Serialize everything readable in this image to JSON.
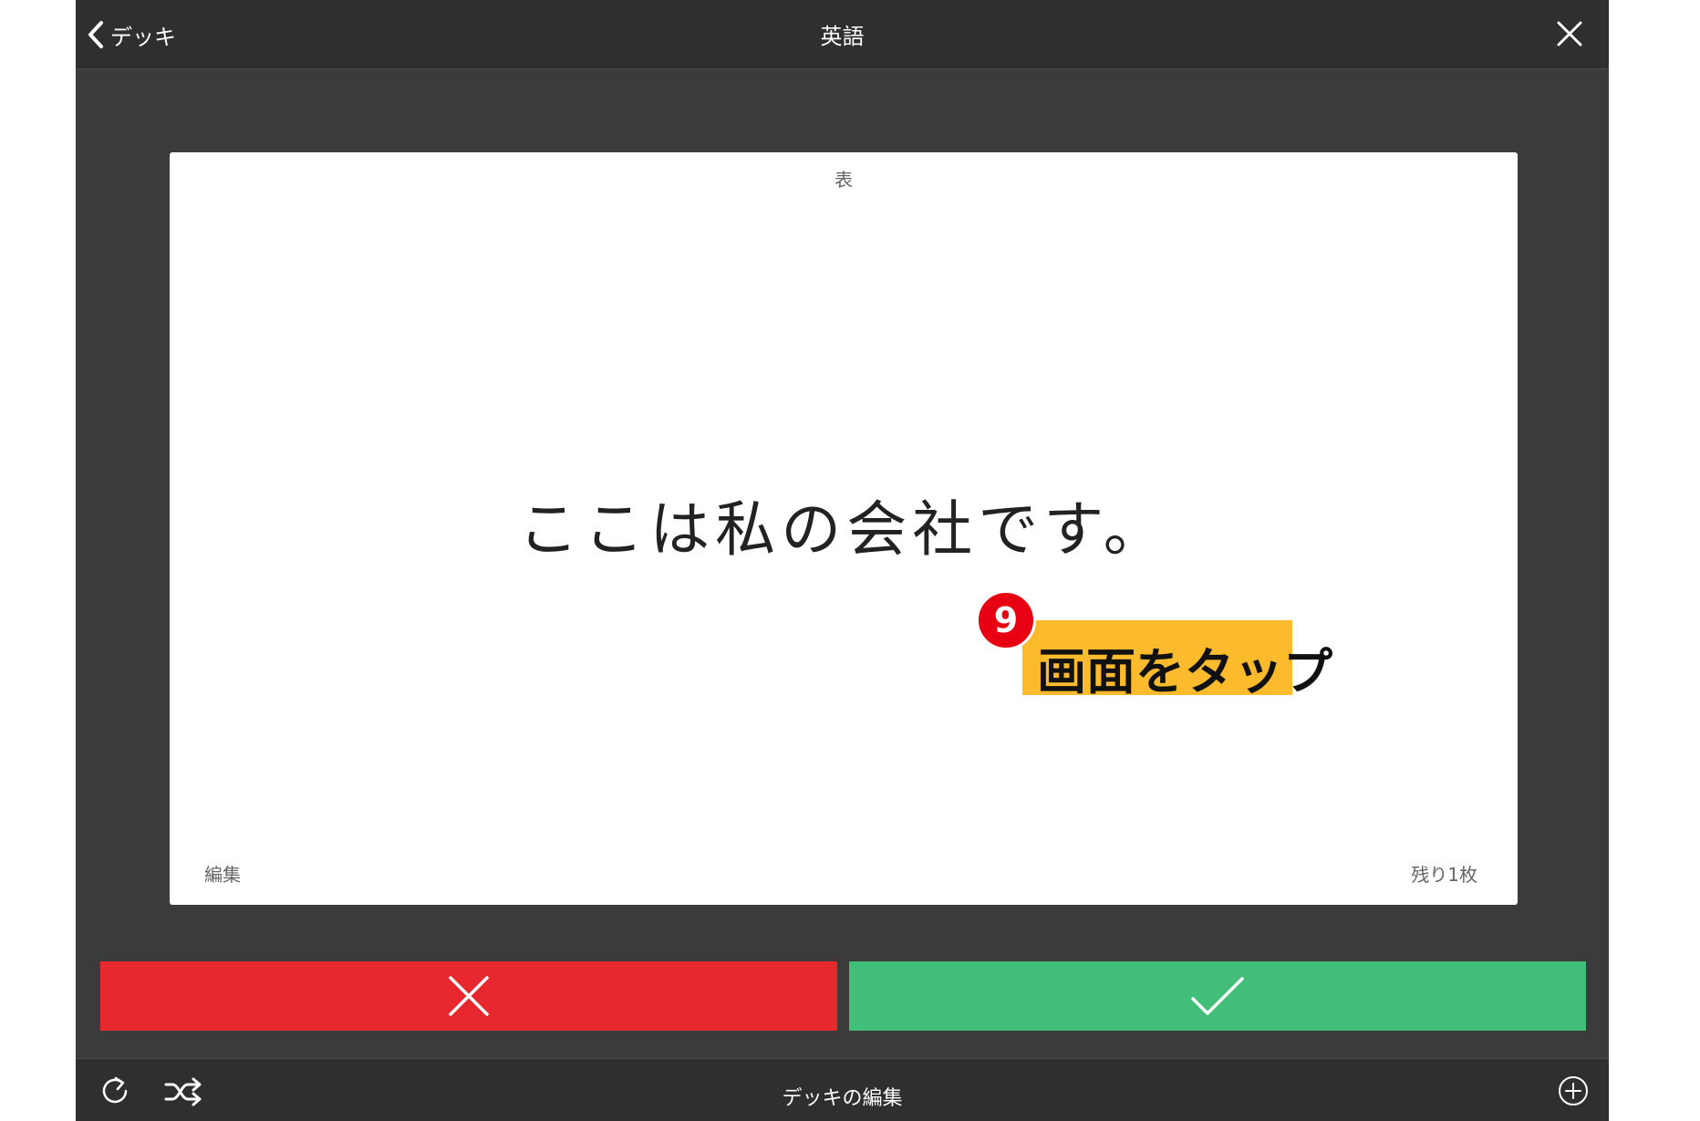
{
  "nav": {
    "back_label": "デッキ",
    "title": "英語",
    "close_icon": "close-icon"
  },
  "card": {
    "side_label": "表",
    "text": "ここは私の会社です。",
    "edit_label": "編集",
    "remaining_label": "残り1枚"
  },
  "annotation": {
    "step_number": "9",
    "instruction": "画面をタップ"
  },
  "answer_buttons": {
    "wrong_icon": "x-icon",
    "correct_icon": "check-icon",
    "colors": {
      "wrong": "#e7282e",
      "correct": "#41bf79"
    }
  },
  "toolbar": {
    "center_label": "デッキの編集",
    "icons": [
      "refresh-icon",
      "shuffle-icon",
      "add-circle-icon"
    ]
  },
  "colors": {
    "nav_background": "#2f2f2f",
    "app_background": "#3b3b3b",
    "callout": "#fbbb2d",
    "badge": "#e60012"
  }
}
